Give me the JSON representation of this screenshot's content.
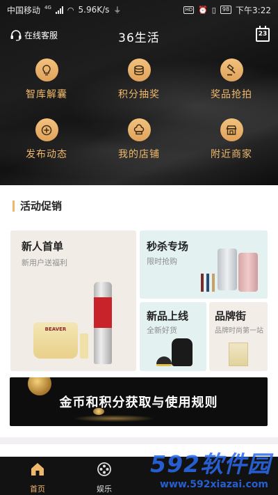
{
  "status_bar": {
    "carrier": "中国移动",
    "network": "4G",
    "speed": "5.96K/s",
    "battery": "98",
    "time": "下午3:22",
    "hd": "HD"
  },
  "header": {
    "customer_service": "在线客服",
    "title": "36生活",
    "calendar_day": "23"
  },
  "features": [
    {
      "label": "智库解囊",
      "icon": "bulb-icon"
    },
    {
      "label": "积分抽奖",
      "icon": "coins-icon"
    },
    {
      "label": "奖品抢拍",
      "icon": "auction-hammer-icon"
    },
    {
      "label": "发布动态",
      "icon": "plus-icon"
    },
    {
      "label": "我的店铺",
      "icon": "chef-hat-icon"
    },
    {
      "label": "附近商家",
      "icon": "storefront-icon"
    }
  ],
  "promo": {
    "section_title": "活动促销",
    "cards": {
      "new_user": {
        "title": "新人首单",
        "subtitle": "新用户送福利",
        "brand": "BEAVER"
      },
      "flash_sale": {
        "title": "秒杀专场",
        "subtitle": "限时抢购"
      },
      "new_arrivals": {
        "title": "新品上线",
        "subtitle": "全新好货"
      },
      "brand_street": {
        "title": "品牌街",
        "subtitle": "品牌时尚第一站"
      }
    },
    "banner": "金币和积分获取与使用规则"
  },
  "tabbar": {
    "tabs": [
      {
        "label": "首页",
        "icon": "home-icon"
      },
      {
        "label": "娱乐",
        "icon": "film-reel-icon"
      }
    ],
    "active_color": "#f0b86a"
  },
  "watermark": {
    "main": "592软件园",
    "url": "www.592xiazai.com"
  },
  "colors": {
    "accent": "#f0b86a",
    "hero_bg": "#151515",
    "tab_bg": "#121212"
  }
}
